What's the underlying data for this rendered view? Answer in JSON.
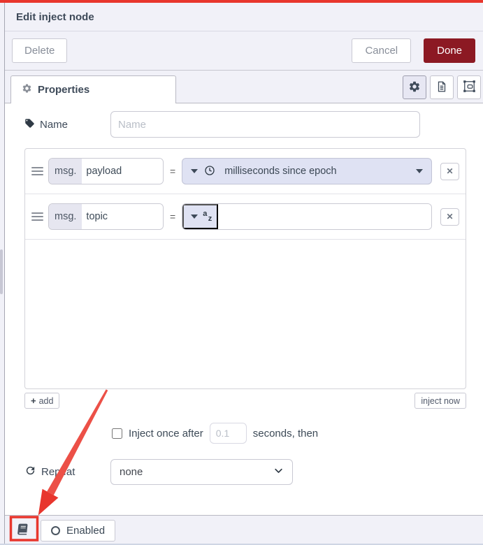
{
  "dialog": {
    "title": "Edit inject node",
    "buttons": {
      "delete": "Delete",
      "cancel": "Cancel",
      "done": "Done"
    },
    "tab": {
      "label": "Properties"
    },
    "name_field": {
      "label": "Name",
      "placeholder": "Name",
      "value": ""
    },
    "props_list": {
      "rows": [
        {
          "prefix": "msg.",
          "key": "payload",
          "eq": "=",
          "type": "timestamp",
          "value_label": "milliseconds since epoch"
        },
        {
          "prefix": "msg.",
          "key": "topic",
          "eq": "=",
          "type": "string",
          "value": ""
        }
      ],
      "add_label": "add",
      "inject_now_label": "inject now"
    },
    "inject_once": {
      "checked": false,
      "label_before": "Inject once after",
      "value": "0.1",
      "label_after": "seconds, then"
    },
    "repeat": {
      "label": "Repeat",
      "value": "none"
    },
    "footer": {
      "enabled_label": "Enabled"
    }
  },
  "icons": {
    "close": "✕",
    "add": "+",
    "az_a": "a",
    "az_z": "z"
  },
  "colors": {
    "accent_red": "#8c1923",
    "annotation_red": "#e8362d",
    "panel_lavender": "#f1f1f8",
    "typed_input_bg": "#dfe2f3",
    "text_dark": "#3e4a59"
  }
}
